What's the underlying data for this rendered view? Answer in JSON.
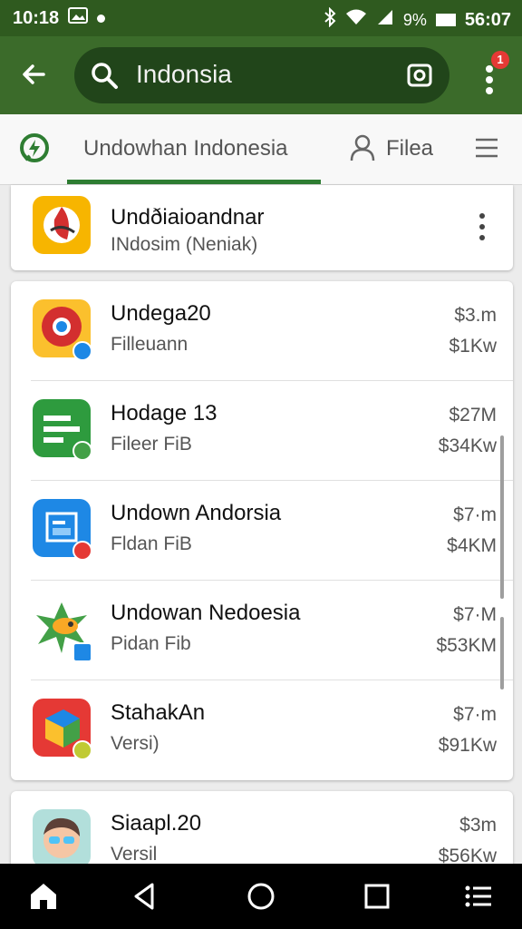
{
  "statusbar": {
    "time_left": "10:18",
    "signal_text": "9%",
    "time_right": "56:07"
  },
  "search": {
    "query": "Indonsia"
  },
  "header": {
    "notification_count": "1"
  },
  "tabs": {
    "main": "Undowhan Indonesia",
    "files": "Filea"
  },
  "featured": {
    "title": "Undðiaioandnar",
    "subtitle": "INdosim (Neniak)"
  },
  "list": [
    {
      "title": "Undega20",
      "subtitle": "Filleuann",
      "value1": "$3.m",
      "value2": "$1Kw"
    },
    {
      "title": "Hodage 13",
      "subtitle": "Fileer FiB",
      "value1": "$27M",
      "value2": "$34Kw"
    },
    {
      "title": "Undown Andorsia",
      "subtitle": "Fldan FiB",
      "value1": "$7·m",
      "value2": "$4KM"
    },
    {
      "title": "Undowan Nedoesia",
      "subtitle": "Pidan Fib",
      "value1": "$7·M",
      "value2": "$53KM"
    },
    {
      "title": "StahakAn",
      "subtitle": "Versi)",
      "value1": "$7·m",
      "value2": "$91Kw"
    }
  ],
  "list_bottom": {
    "title": "Siaapl.20",
    "subtitle": "Versil",
    "value1": "$3m",
    "value2": "$56Kw"
  },
  "colors": {
    "statusbar": "#2f5a1f",
    "appbar": "#3b6b2a",
    "search_bg": "#21451a",
    "tab_underline": "#2e7d32",
    "badge": "#e53935"
  },
  "icons": [
    "bluetooth-icon",
    "wifi-icon",
    "signal-icon",
    "battery-icon",
    "back-arrow-icon",
    "search-icon",
    "camera-icon",
    "overflow-menu-icon",
    "app-logo-icon",
    "person-icon",
    "hamburger-menu-icon",
    "home-icon",
    "back-triangle-icon",
    "circle-home-icon",
    "recents-square-icon",
    "list-menu-icon"
  ]
}
